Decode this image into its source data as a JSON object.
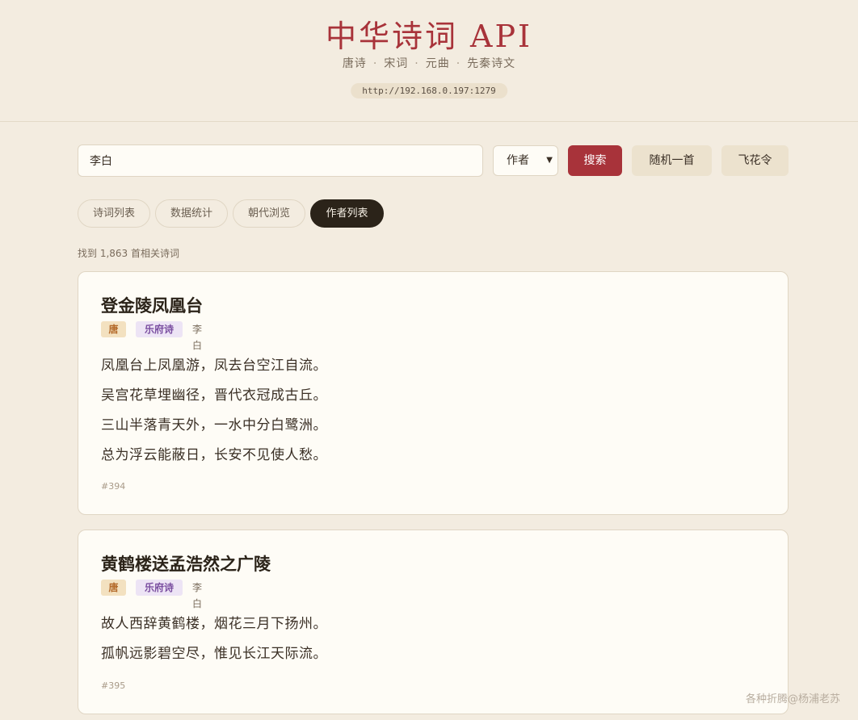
{
  "header": {
    "title": "中华诗词 API",
    "subtitle": [
      "唐诗",
      "宋词",
      "元曲",
      "先秦诗文"
    ],
    "subtitle_sep": "·",
    "api_url": "http://192.168.0.197:1279"
  },
  "search": {
    "value": "李白",
    "field": "作者",
    "search_label": "搜索",
    "random_label": "随机一首",
    "feihua_label": "飞花令"
  },
  "tabs": [
    {
      "label": "诗词列表",
      "active": false
    },
    {
      "label": "数据统计",
      "active": false
    },
    {
      "label": "朝代浏览",
      "active": false
    },
    {
      "label": "作者列表",
      "active": true
    }
  ],
  "result_count": "找到 1,863 首相关诗词",
  "poems": [
    {
      "title": "登金陵凤凰台",
      "dynasty": "唐",
      "genre": "乐府诗",
      "author": "李白",
      "lines": [
        "凤凰台上凤凰游，凤去台空江自流。",
        "吴宫花草埋幽径，晋代衣冠成古丘。",
        "三山半落青天外，一水中分白鹭洲。",
        "总为浮云能蔽日，长安不见使人愁。"
      ],
      "id": "#394"
    },
    {
      "title": "黄鹤楼送孟浩然之广陵",
      "dynasty": "唐",
      "genre": "乐府诗",
      "author": "李白",
      "lines": [
        "故人西辞黄鹤楼，烟花三月下扬州。",
        "孤帆远影碧空尽，惟见长江天际流。"
      ],
      "id": "#395"
    }
  ],
  "watermark": "各种折腾@杨浦老苏",
  "colors": {
    "background": "#f3ece0",
    "accent": "#a8333a",
    "card": "#fefcf6",
    "tab_active": "#2b2319",
    "tag_dynasty": "#f3e1c0",
    "tag_genre": "#ede4f5"
  }
}
